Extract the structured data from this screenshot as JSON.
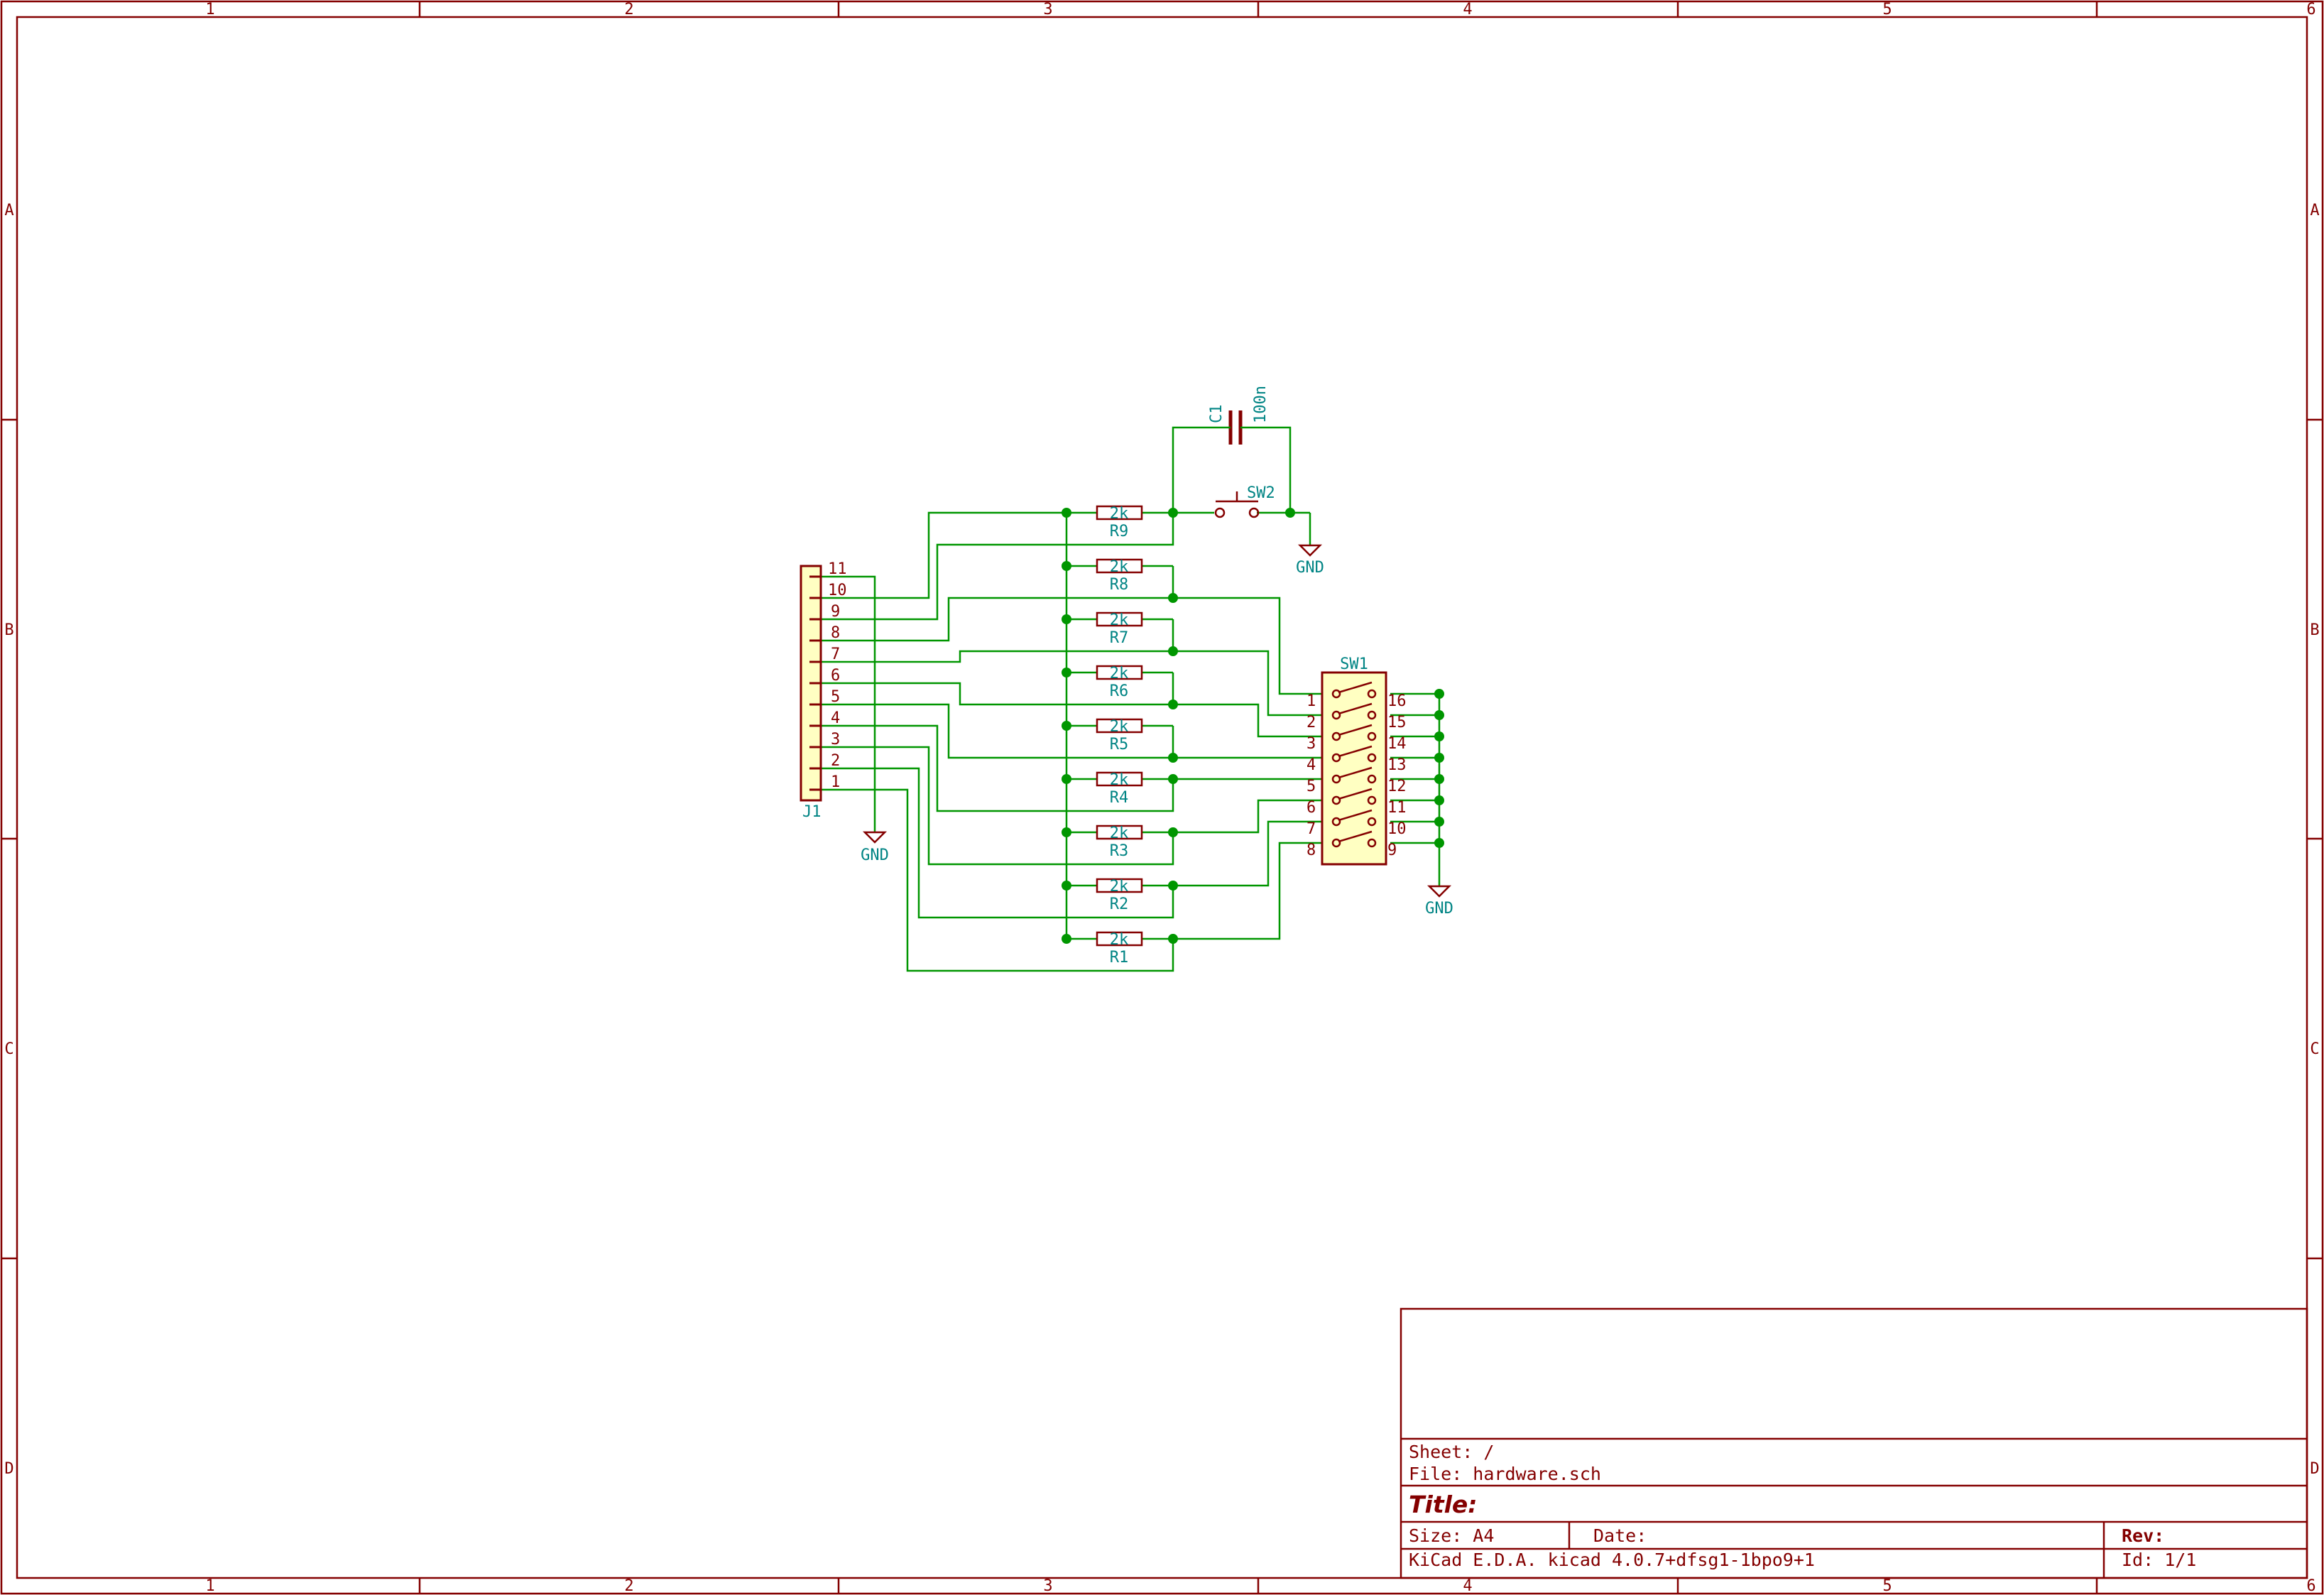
{
  "frame": {
    "columns": [
      "1",
      "2",
      "3",
      "4",
      "5",
      "6"
    ],
    "rows": [
      "A",
      "B",
      "C",
      "D"
    ]
  },
  "title_block": {
    "sheet": "Sheet: /",
    "file": "File: hardware.sch",
    "title": "Title:",
    "size": "Size: A4",
    "date": "Date:",
    "rev": "Rev:",
    "tool": "KiCad E.D.A.  kicad 4.0.7+dfsg1-1bpo9+1",
    "id": "Id: 1/1"
  },
  "connector": {
    "ref": "J1",
    "pins": [
      "11",
      "10",
      "9",
      "8",
      "7",
      "6",
      "5",
      "4",
      "3",
      "2",
      "1"
    ]
  },
  "resistors": [
    {
      "ref": "R9",
      "value": "2k"
    },
    {
      "ref": "R8",
      "value": "2k"
    },
    {
      "ref": "R7",
      "value": "2k"
    },
    {
      "ref": "R6",
      "value": "2k"
    },
    {
      "ref": "R5",
      "value": "2k"
    },
    {
      "ref": "R4",
      "value": "2k"
    },
    {
      "ref": "R3",
      "value": "2k"
    },
    {
      "ref": "R2",
      "value": "2k"
    },
    {
      "ref": "R1",
      "value": "2k"
    }
  ],
  "capacitor": {
    "ref": "C1",
    "value": "100n"
  },
  "pushbutton": {
    "ref": "SW2"
  },
  "dip_switch": {
    "ref": "SW1",
    "left_pins": [
      "1",
      "2",
      "3",
      "4",
      "5",
      "6",
      "7",
      "8"
    ],
    "right_pins": [
      "16",
      "15",
      "14",
      "13",
      "12",
      "11",
      "10",
      "9"
    ]
  },
  "power": {
    "gnd_label": "GND"
  }
}
